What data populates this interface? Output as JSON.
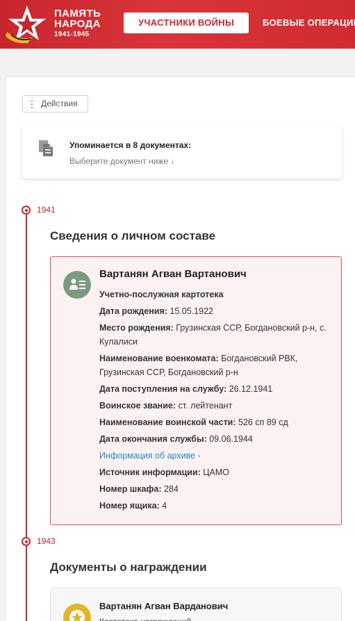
{
  "header": {
    "brand_line1": "ПАМЯТЬ",
    "brand_line2": "НАРОДА",
    "brand_years": "1941-1945",
    "nav_active": "УЧАСТНИКИ ВОЙНЫ",
    "nav_next": "БОЕВЫЕ ОПЕРАЦИИ"
  },
  "toolbar": {
    "actions_label": "Действия"
  },
  "mentions": {
    "title": "Упоминается в 8 документах:",
    "subtitle": "Выберите документ ниже ↓"
  },
  "timeline": [
    {
      "year": "1941",
      "section_title": "Сведения о личном составе",
      "record": {
        "name": "Вартанян Агван Вартанович",
        "kind": "Учетно-послужная картотека",
        "fields": [
          {
            "label": "Дата рождения:",
            "value": " 15.05.1922"
          },
          {
            "label": "Место рождения:",
            "value": " Грузинская ССР, Богдановский р-н, с. Кулалиси"
          },
          {
            "label": "Наименование военкомата:",
            "value": " Богдановский РВК, Грузинская ССР, Богдановский р-н"
          },
          {
            "label": "Дата поступления на службу:",
            "value": " 26.12.1941"
          },
          {
            "label": "Воинское звание:",
            "value": " ст. лейтенант"
          },
          {
            "label": "Наименование воинской части:",
            "value": " 526 сп 89 сд"
          },
          {
            "label": "Дата окончания службы:",
            "value": " 09.06.1944"
          },
          {
            "link": "Информация об архиве -"
          },
          {
            "label": "Источник информации:",
            "value": " ЦАМО"
          },
          {
            "label": "Номер шкафа:",
            "value": " 284"
          },
          {
            "label": "Номер ящика:",
            "value": " 4"
          }
        ]
      }
    },
    {
      "year": "1943",
      "section_title": "Документы о награждении",
      "record": {
        "name": "Вартанян Агван Варданович",
        "kind": "Картотека награждений"
      }
    }
  ],
  "colors": {
    "brand_red": "#c8262d",
    "record_border": "#e24b52",
    "record_bg": "#fdf2f2",
    "link_blue": "#1e88c8",
    "avatar_green": "#7d9a80",
    "medal_gold": "#e2b52a"
  },
  "icons": {
    "logo": "star-logo-icon",
    "actions": "vertical-dots-icon",
    "mentions": "documents-icon",
    "record": "personnel-card-icon",
    "award": "medal-star-icon"
  }
}
